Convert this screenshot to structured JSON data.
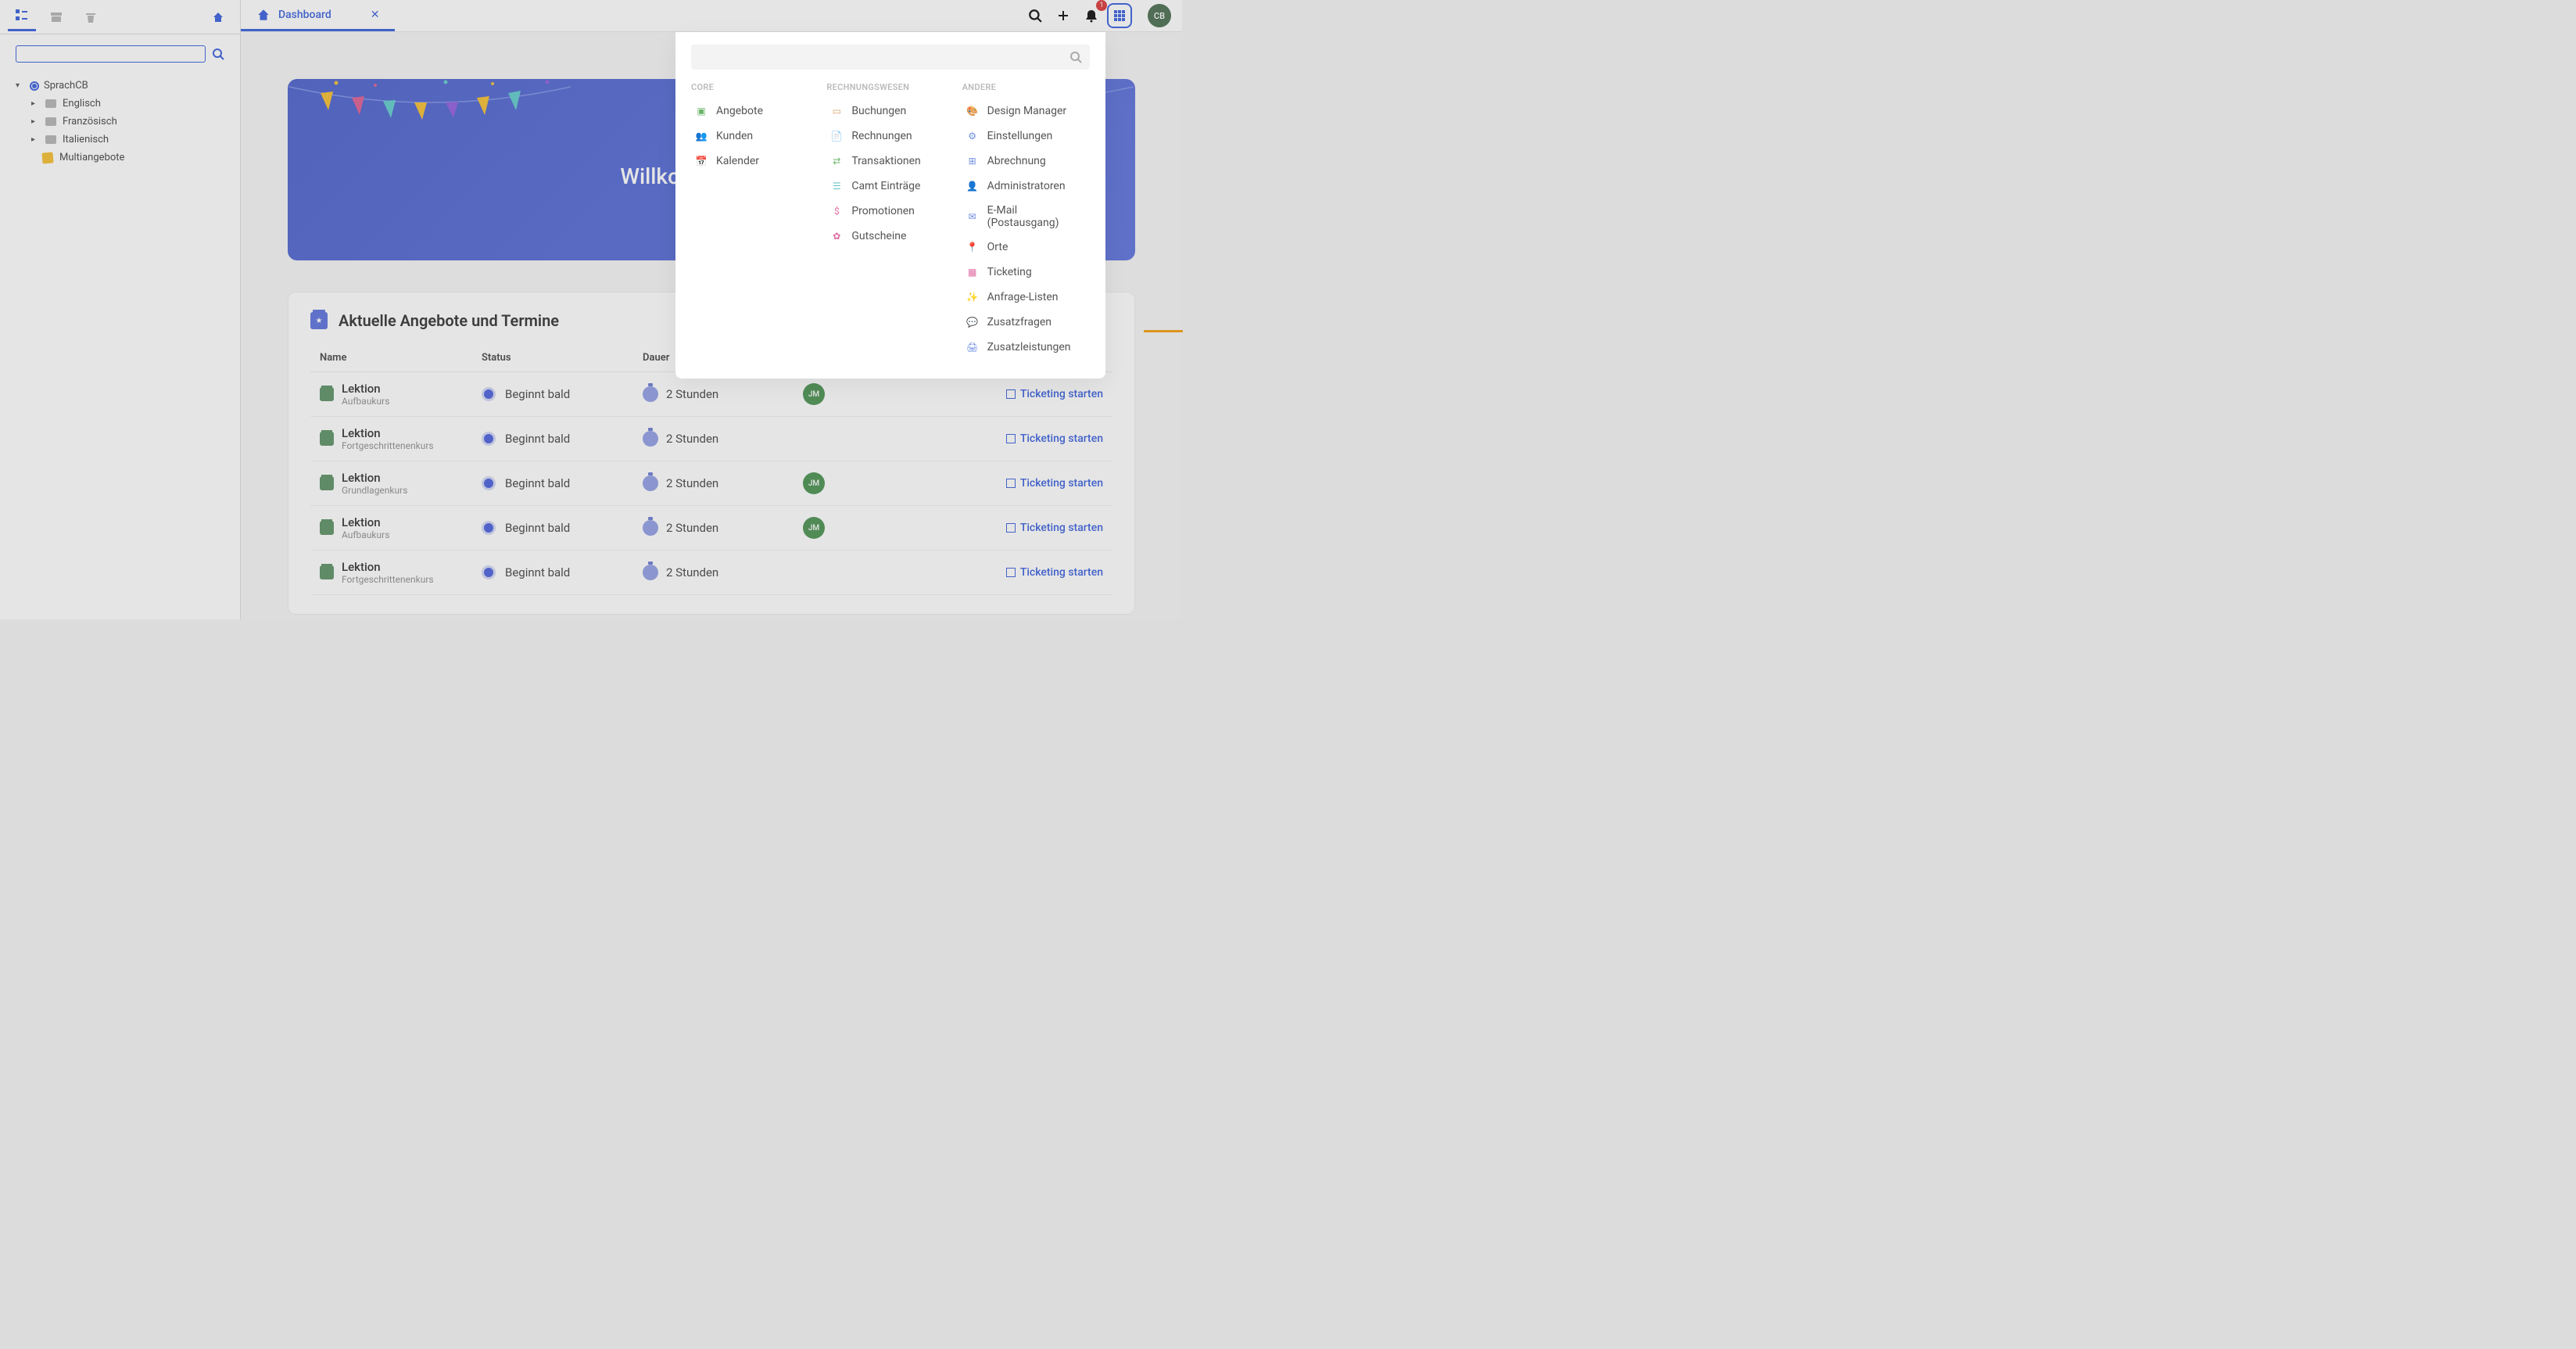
{
  "sidebar": {
    "searchPlaceholder": "",
    "root": "SprachCB",
    "children": [
      "Englisch",
      "Französisch",
      "Italienisch"
    ],
    "leaf": "Multiangebote"
  },
  "tab": {
    "label": "Dashboard"
  },
  "header": {
    "notificationCount": "1",
    "avatarInitials": "CB"
  },
  "hero": {
    "title": "Willkommen Cindy"
  },
  "panel": {
    "title": "Aktuelle Angebote und Termine",
    "columns": {
      "name": "Name",
      "status": "Status",
      "dauer": "Dauer"
    },
    "rows": [
      {
        "title": "Lektion",
        "sub": "Aufbaukurs",
        "status": "Beginnt bald",
        "duration": "2 Stunden",
        "person": "JM",
        "action": "Ticketing starten"
      },
      {
        "title": "Lektion",
        "sub": "Fortgeschrittenenkurs",
        "status": "Beginnt bald",
        "duration": "2 Stunden",
        "person": "",
        "action": "Ticketing starten"
      },
      {
        "title": "Lektion",
        "sub": "Grundlagenkurs",
        "status": "Beginnt bald",
        "duration": "2 Stunden",
        "person": "JM",
        "action": "Ticketing starten"
      },
      {
        "title": "Lektion",
        "sub": "Aufbaukurs",
        "status": "Beginnt bald",
        "duration": "2 Stunden",
        "person": "JM",
        "action": "Ticketing starten"
      },
      {
        "title": "Lektion",
        "sub": "Fortgeschrittenenkurs",
        "status": "Beginnt bald",
        "duration": "2 Stunden",
        "person": "",
        "action": "Ticketing starten"
      }
    ]
  },
  "apps": {
    "searchPlaceholder": "",
    "columns": [
      {
        "heading": "CORE",
        "items": [
          {
            "label": "Angebote",
            "iconColor": "c-green",
            "glyph": "▣"
          },
          {
            "label": "Kunden",
            "iconColor": "c-blue",
            "glyph": "👥"
          },
          {
            "label": "Kalender",
            "iconColor": "c-blue",
            "glyph": "📅"
          }
        ]
      },
      {
        "heading": "RECHNUNGSWESEN",
        "items": [
          {
            "label": "Buchungen",
            "iconColor": "c-orange",
            "glyph": "▭"
          },
          {
            "label": "Rechnungen",
            "iconColor": "c-green",
            "glyph": "📄"
          },
          {
            "label": "Transaktionen",
            "iconColor": "c-green",
            "glyph": "⇄"
          },
          {
            "label": "Camt Einträge",
            "iconColor": "c-teal",
            "glyph": "☰"
          },
          {
            "label": "Promotionen",
            "iconColor": "c-pink",
            "glyph": "$"
          },
          {
            "label": "Gutscheine",
            "iconColor": "c-pink",
            "glyph": "✿"
          }
        ]
      },
      {
        "heading": "ANDERE",
        "items": [
          {
            "label": "Design Manager",
            "iconColor": "c-teal",
            "glyph": "🎨"
          },
          {
            "label": "Einstellungen",
            "iconColor": "c-blue",
            "glyph": "⚙"
          },
          {
            "label": "Abrechnung",
            "iconColor": "c-blue",
            "glyph": "⊞"
          },
          {
            "label": "Administratoren",
            "iconColor": "c-blue",
            "glyph": "👤"
          },
          {
            "label": "E-Mail (Postausgang)",
            "iconColor": "c-blue",
            "glyph": "✉"
          },
          {
            "label": "Orte",
            "iconColor": "c-purple",
            "glyph": "📍"
          },
          {
            "label": "Ticketing",
            "iconColor": "c-pink",
            "glyph": "▦"
          },
          {
            "label": "Anfrage-Listen",
            "iconColor": "c-purple",
            "glyph": "✨"
          },
          {
            "label": "Zusatzfragen",
            "iconColor": "c-blue",
            "glyph": "💬"
          },
          {
            "label": "Zusatzleistungen",
            "iconColor": "c-blue",
            "glyph": "🖨"
          }
        ]
      }
    ]
  }
}
